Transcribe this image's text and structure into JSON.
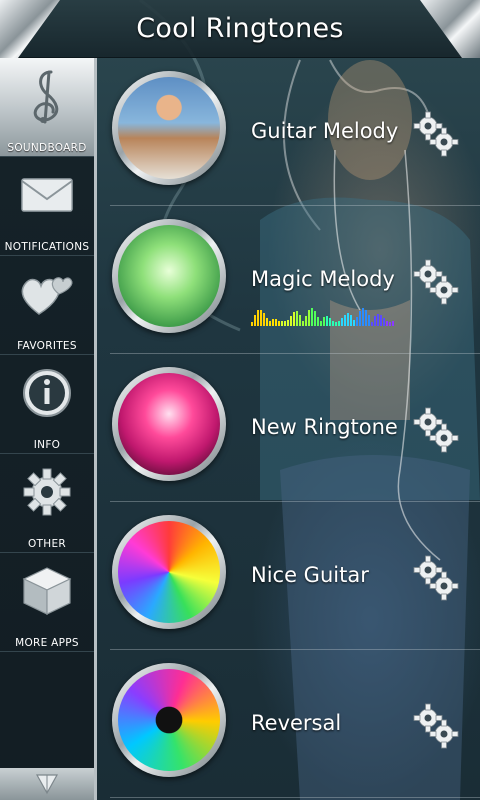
{
  "app": {
    "title": "Cool Ringtones"
  },
  "sidebar": {
    "items": [
      {
        "label": "SOUNDBOARD",
        "icon": "treble-clef-icon",
        "active": true
      },
      {
        "label": "NOTIFICATIONS",
        "icon": "envelope-icon"
      },
      {
        "label": "FAVORITES",
        "icon": "hearts-icon"
      },
      {
        "label": "INFO",
        "icon": "info-icon"
      },
      {
        "label": "OTHER",
        "icon": "gear-icon"
      },
      {
        "label": "MORE APPS",
        "icon": "cube-icon"
      }
    ],
    "bottom_icon": "paper-plane-icon"
  },
  "ringtones": [
    {
      "name": "Guitar Melody",
      "thumb": "girl-with-guitar"
    },
    {
      "name": "Magic Melody",
      "thumb": "green-sparkles",
      "playing": true
    },
    {
      "name": "New Ringtone",
      "thumb": "concert-crowd"
    },
    {
      "name": "Nice Guitar",
      "thumb": "rainbow-guitar"
    },
    {
      "name": "Reversal",
      "thumb": "speaker-burst"
    }
  ],
  "colors": {
    "background": "#1d3038",
    "chrome": "#b8c0c4",
    "text": "#ffffff"
  }
}
